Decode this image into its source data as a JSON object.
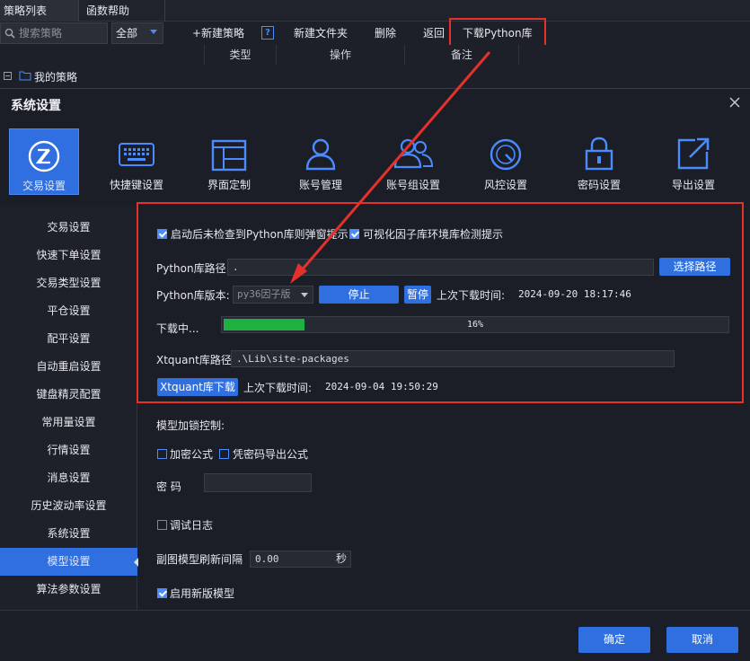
{
  "bg_window": {
    "tabs": [
      "策略列表",
      "函数帮助"
    ],
    "search_placeholder": "搜索策略",
    "filter_value": "全部",
    "toolbar": {
      "new_strategy": "+新建策略",
      "help": "?",
      "new_folder": "新建文件夹",
      "delete": "删除",
      "back": "返回",
      "download_python": "下载Python库"
    },
    "columns": [
      "类型",
      "操作",
      "备注"
    ],
    "tree_root": "我的策略"
  },
  "dialog": {
    "title": "系统设置",
    "categories": [
      {
        "label": "交易设置",
        "icon": "trade-icon"
      },
      {
        "label": "快捷键设置",
        "icon": "keyboard-icon"
      },
      {
        "label": "界面定制",
        "icon": "layout-icon"
      },
      {
        "label": "账号管理",
        "icon": "user-icon"
      },
      {
        "label": "账号组设置",
        "icon": "user-group-icon"
      },
      {
        "label": "风控设置",
        "icon": "gauge-icon"
      },
      {
        "label": "密码设置",
        "icon": "lock-icon"
      },
      {
        "label": "导出设置",
        "icon": "export-icon"
      }
    ],
    "active_category": "交易设置",
    "sidebar": [
      "交易设置",
      "快速下单设置",
      "交易类型设置",
      "平仓设置",
      "配平设置",
      "自动重启设置",
      "键盘精灵配置",
      "常用量设置",
      "行情设置",
      "消息设置",
      "历史波动率设置",
      "系统设置",
      "模型设置",
      "算法参数设置"
    ],
    "sidebar_active": "模型设置",
    "python": {
      "check_popup_label": "启动后未检查到Python库则弹窗提示",
      "check_popup_on": true,
      "factor_check_label": "可视化因子库环境库检测提示",
      "factor_check_on": true,
      "path_label": "Python库路径",
      "path_value": ".",
      "choose_path": "选择路径",
      "version_label": "Python库版本:",
      "version_value": "py36因子版",
      "stop": "停止",
      "pause": "暂停",
      "last_download_label": "上次下载时间:",
      "last_download_time": "2024-09-20 18:17:46",
      "downloading_label": "下载中...",
      "progress_percent": 16,
      "progress_text": "16%"
    },
    "xtquant": {
      "path_label": "Xtquant库路径",
      "path_value": ".\\Lib\\site-packages",
      "download_btn": "Xtquant库下载",
      "last_download_label": "上次下载时间:",
      "last_download_time": "2024-09-04 19:50:29"
    },
    "model": {
      "lock_title": "模型加锁控制:",
      "encrypt_label": "加密公式",
      "encrypt_on": false,
      "export_label": "凭密码导出公式",
      "export_on": false,
      "password_label": "密    码",
      "debug_label": "调试日志",
      "debug_on": false,
      "refresh_label": "副图模型刷新间隔",
      "refresh_value": "0.00",
      "refresh_unit": "秒",
      "new_model_label": "启用新版模型",
      "new_model_on": true
    },
    "ok": "确定",
    "cancel": "取消"
  },
  "colors": {
    "accent": "#2f6fe0",
    "highlight_red": "#e5312c",
    "progress_green": "#1eb040"
  }
}
